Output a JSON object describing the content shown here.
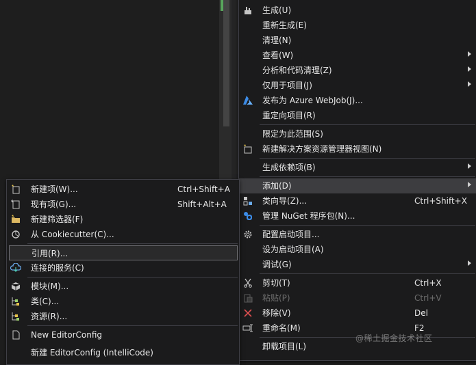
{
  "context_menu": {
    "top_partial": "生成(U)",
    "items": [
      {
        "label": "生成(U)",
        "icon": "build-icon"
      },
      {
        "label": "重新生成(E)"
      },
      {
        "label": "清理(N)"
      },
      {
        "label": "查看(W)",
        "submenu": true
      },
      {
        "label": "分析和代码清理(Z)",
        "submenu": true
      },
      {
        "label": "仅用于项目(J)",
        "submenu": true
      },
      {
        "label": "发布为 Azure WebJob(J)...",
        "icon": "azure-icon"
      },
      {
        "label": "重定向项目(R)"
      },
      {
        "label": "限定为此范围(S)"
      },
      {
        "label": "新建解决方案资源管理器视图(N)",
        "icon": "new-view-icon"
      },
      {
        "label": "生成依赖项(B)",
        "submenu": true
      },
      {
        "label": "添加(D)",
        "submenu": true,
        "selected": true
      },
      {
        "label": "类向导(Z)...",
        "shortcut": "Ctrl+Shift+X",
        "icon": "class-wizard-icon"
      },
      {
        "label": "管理 NuGet 程序包(N)...",
        "icon": "nuget-icon"
      },
      {
        "label": "配置启动项目...",
        "icon": "gear-icon"
      },
      {
        "label": "设为启动项目(A)"
      },
      {
        "label": "调试(G)",
        "submenu": true
      },
      {
        "label": "剪切(T)",
        "shortcut": "Ctrl+X",
        "icon": "scissors-icon"
      },
      {
        "label": "粘贴(P)",
        "shortcut": "Ctrl+V",
        "icon": "paste-icon",
        "disabled": true
      },
      {
        "label": "移除(V)",
        "shortcut": "Del",
        "icon": "remove-icon"
      },
      {
        "label": "重命名(M)",
        "shortcut": "F2",
        "icon": "rename-icon"
      },
      {
        "label": "卸载项目(L)"
      }
    ]
  },
  "add_submenu": {
    "items": [
      {
        "label": "新建项(W)...",
        "shortcut": "Ctrl+Shift+A",
        "icon": "new-item-icon"
      },
      {
        "label": "现有项(G)...",
        "shortcut": "Shift+Alt+A",
        "icon": "existing-item-icon"
      },
      {
        "label": "新建筛选器(F)",
        "icon": "folder-icon"
      },
      {
        "label": "从 Cookiecutter(C)...",
        "icon": "cookiecutter-icon"
      },
      {
        "label": "引用(R)...",
        "selected": true
      },
      {
        "label": "连接的服务(C)",
        "icon": "connected-service-icon"
      },
      {
        "label": "模块(M)...",
        "icon": "module-icon"
      },
      {
        "label": "类(C)...",
        "icon": "class-icon"
      },
      {
        "label": "资源(R)...",
        "icon": "resource-icon"
      },
      {
        "label": "New EditorConfig",
        "icon": "editorconfig-icon"
      },
      {
        "label": "新建 EditorConfig (IntelliCode)"
      }
    ]
  },
  "watermark": "@稀土掘金技术社区",
  "colors": {
    "menu_bg": "#1b1b1c",
    "selected_bg": "#3d3d40",
    "text": "#e8e8e8",
    "disabled": "#6d6d6d",
    "azure_blue": "#3c8ce7",
    "remove_red": "#e05050"
  }
}
